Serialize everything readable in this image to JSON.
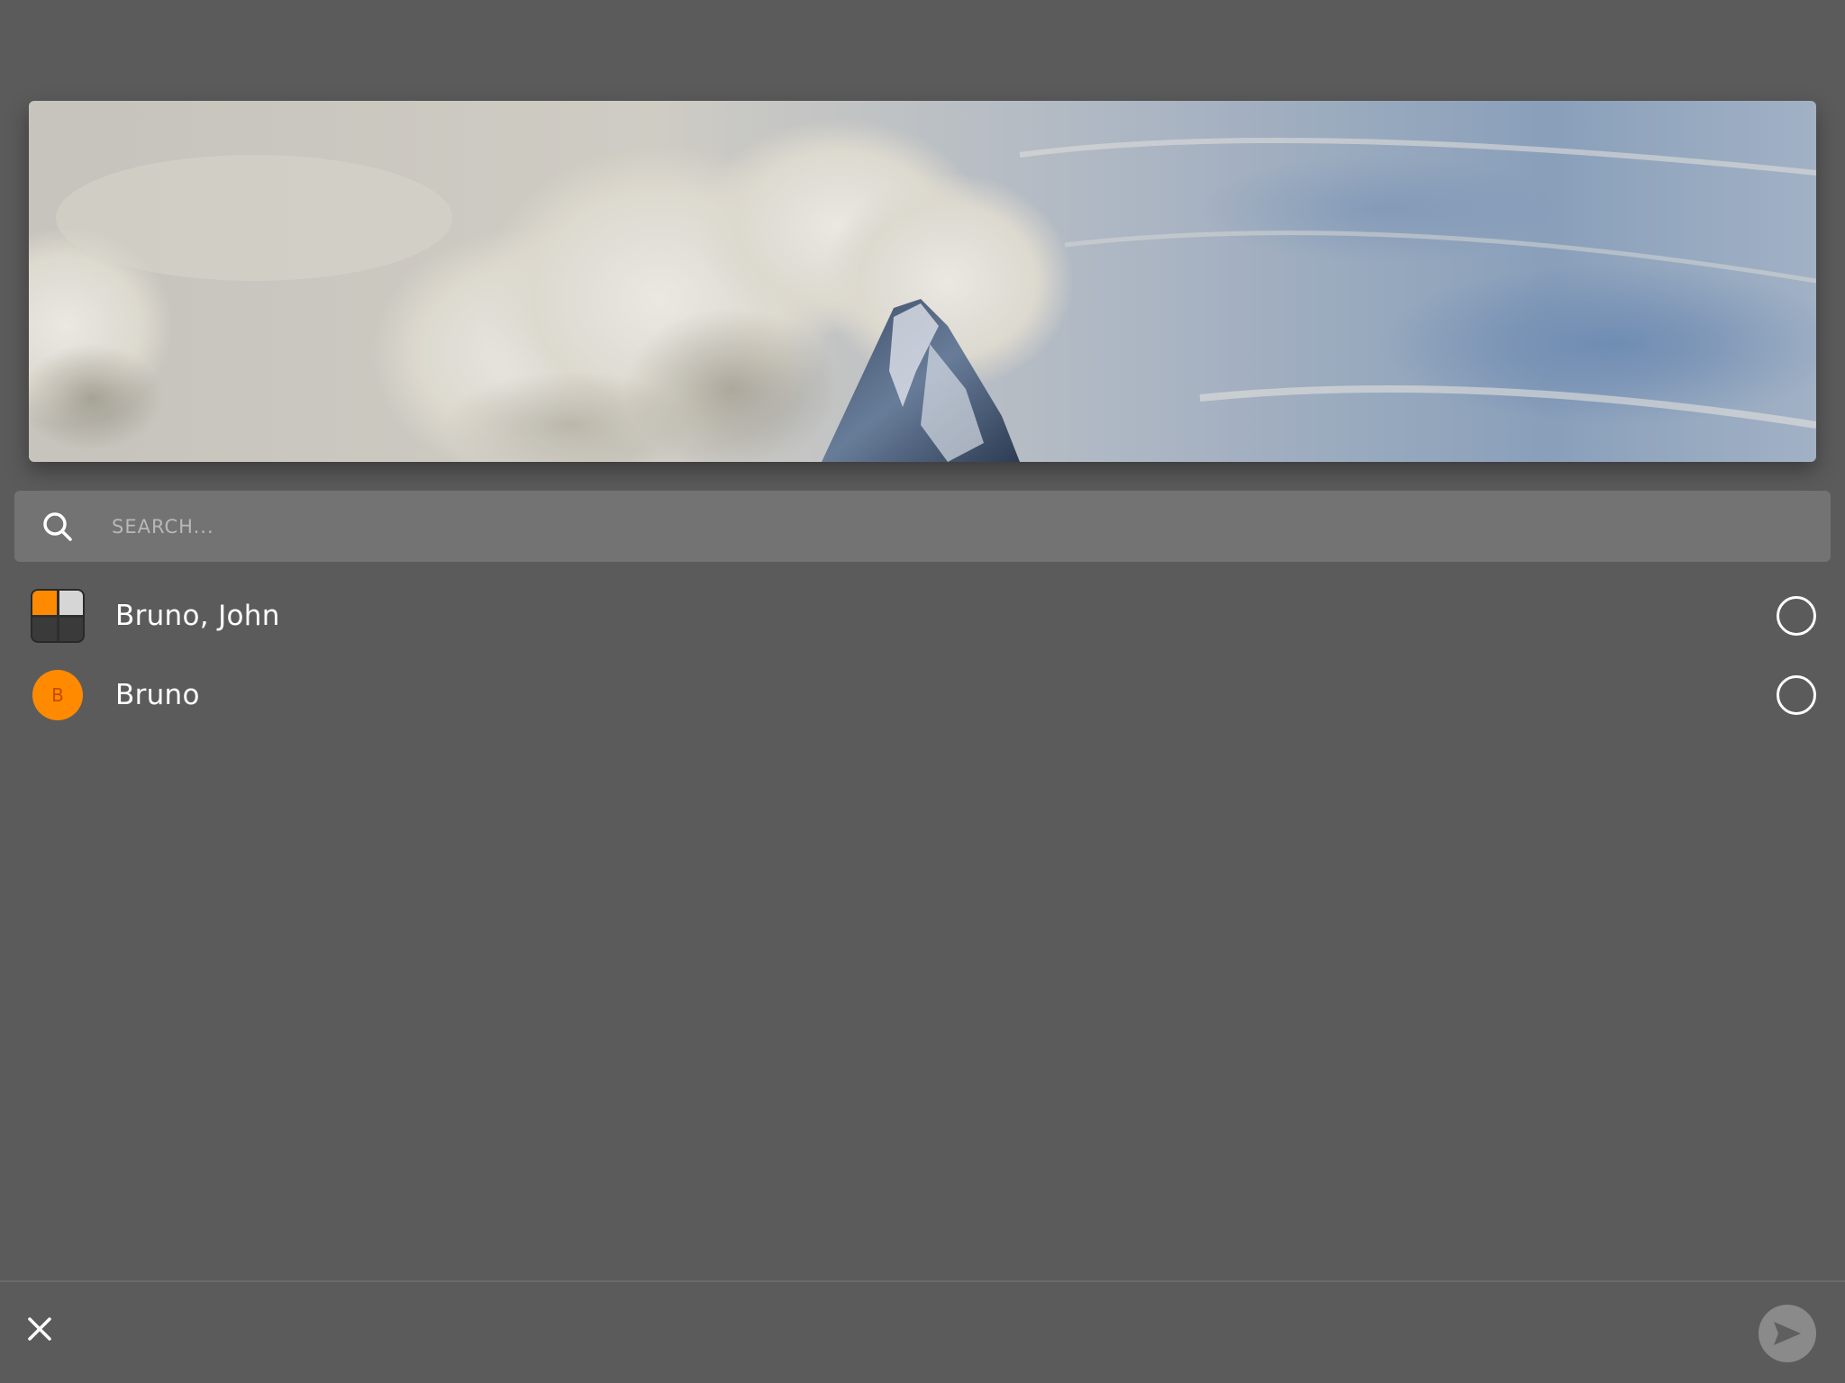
{
  "header": {
    "image": "mountain-peak-clouds-banner"
  },
  "search": {
    "placeholder": "SEARCH...",
    "value": "",
    "icon": "search-icon"
  },
  "contacts": [
    {
      "name": "Bruno, John",
      "avatar": "group-avatar",
      "selected": false
    },
    {
      "name": "Bruno",
      "avatar_letter": "B",
      "selected": false
    }
  ],
  "bottom_bar": {
    "close_icon": "close-icon",
    "send_icon": "send-icon"
  },
  "colors": {
    "background": "#5b5b5b",
    "search_bg": "#737373",
    "accent": "#ff8a00",
    "send_button": "#8a8a8a"
  }
}
